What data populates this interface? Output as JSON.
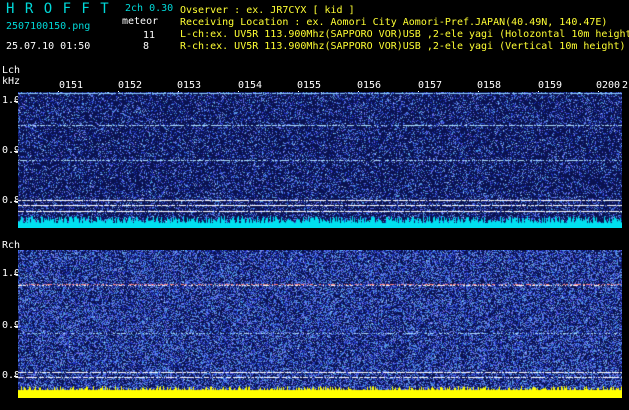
{
  "header": {
    "logo": "H R O F F T",
    "mode": "2ch 0.30",
    "filename": "2507100150.png",
    "meteor_label": "meteor",
    "lch_count": "11",
    "rch_count": "8",
    "datetime": "25.07.10 01:50"
  },
  "info": {
    "observer": "Ovserver          : ex. JR7CYX [ kid ]",
    "location": "Receiving Location : ex. Aomori City Aomori-Pref.JAPAN(40.49N, 140.47E)",
    "lch": "L-ch:ex. UV5R 113.900Mhz(SAPPORO VOR)USB ,2-ele yagi (Holozontal 10m height)",
    "rch": "R-ch:ex. UV5R 113.900Mhz(SAPPORO VOR)USB ,2-ele yagi (Vertical 10m height)"
  },
  "channels": {
    "lch_label": "Lch",
    "unit_label": "kHz",
    "rch_label": "Rch"
  },
  "x_axis": {
    "ticks": [
      "0151",
      "0152",
      "0153",
      "0154",
      "0155",
      "0156",
      "0157",
      "0158",
      "0159",
      "0200",
      "2"
    ]
  },
  "y_axis": {
    "ticks": [
      "1.0",
      "0.9",
      "0.8"
    ]
  },
  "colors": {
    "header_cyan": "#00d8d8",
    "background": "#000000",
    "lch_baseline": "#00e0f0",
    "rch_baseline": "#ffff00",
    "spectrogram_blue": "#1a2fa8"
  }
}
